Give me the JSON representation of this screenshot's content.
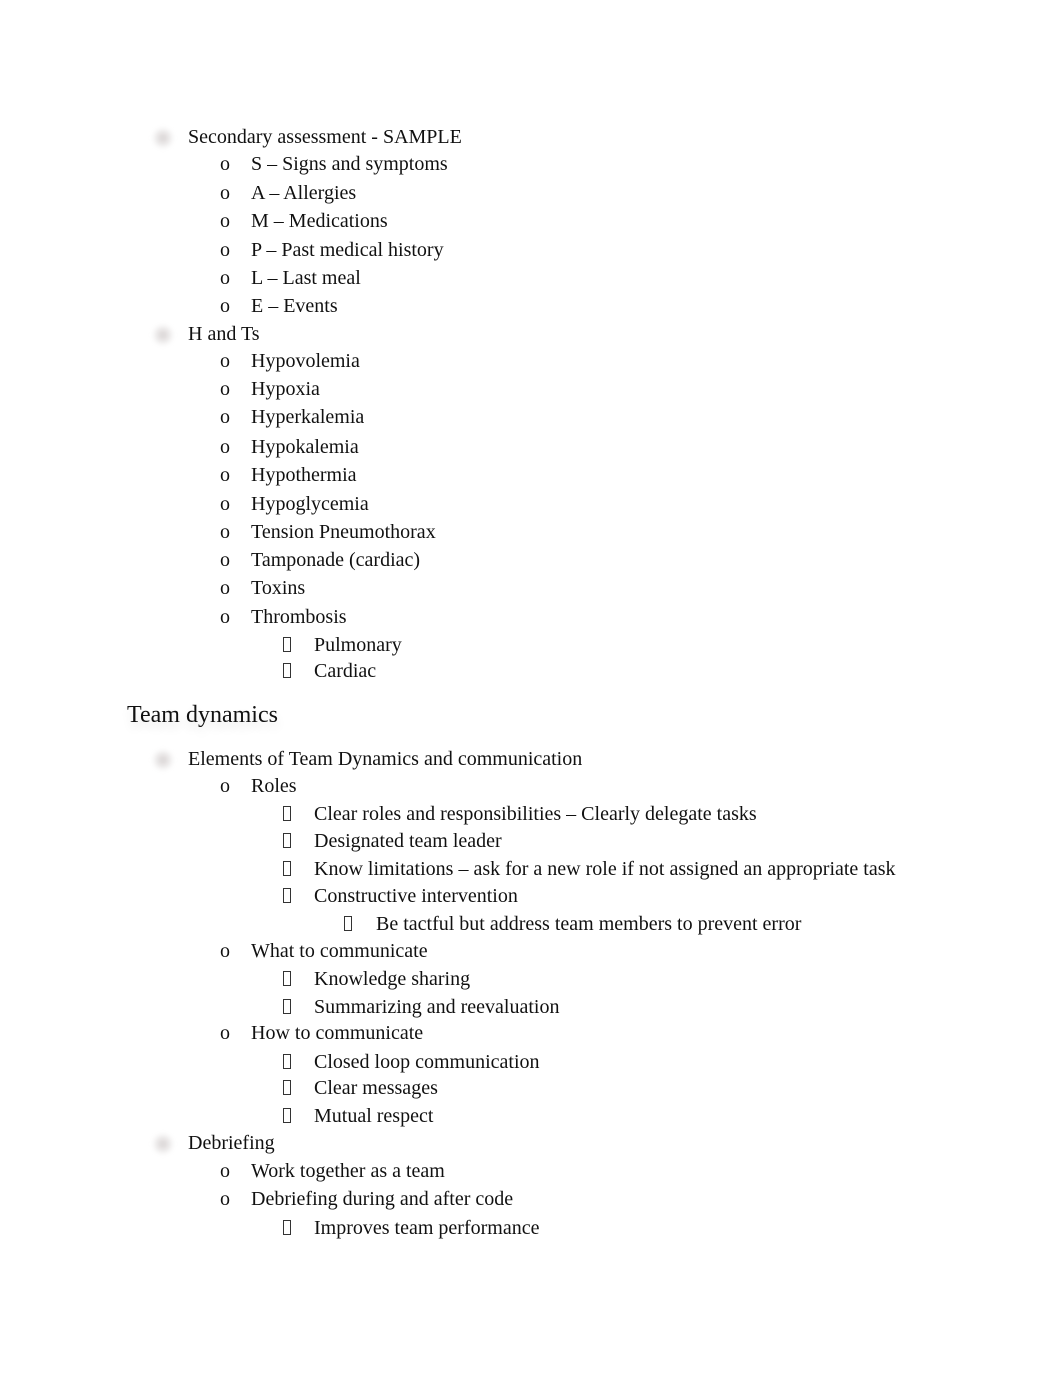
{
  "document": {
    "sections": [
      {
        "items": [
          {
            "label": "Secondary assessment - SAMPLE",
            "children": [
              {
                "label": "S – Signs and symptoms"
              },
              {
                "label": "A – Allergies"
              },
              {
                "label": "M – Medications"
              },
              {
                "label": "P – Past medical history"
              },
              {
                "label": "L – Last meal"
              },
              {
                "label": "E – Events"
              }
            ]
          },
          {
            "label": "H and Ts",
            "children": [
              {
                "label": "Hypovolemia"
              },
              {
                "label": "Hypoxia"
              },
              {
                "label": "Hyperkalemia"
              },
              {
                "label": "Hypokalemia"
              },
              {
                "label": "Hypothermia"
              },
              {
                "label": "Hypoglycemia"
              },
              {
                "label": "Tension Pneumothorax"
              },
              {
                "label": "Tamponade (cardiac)"
              },
              {
                "label": "Toxins"
              },
              {
                "label": "Thrombosis",
                "children": [
                  {
                    "label": "Pulmonary"
                  },
                  {
                    "label": "Cardiac"
                  }
                ]
              }
            ]
          }
        ]
      },
      {
        "heading": "Team dynamics",
        "items": [
          {
            "label": "Elements of Team Dynamics and communication",
            "children": [
              {
                "label": "Roles",
                "children": [
                  {
                    "label": "Clear roles and responsibilities – Clearly delegate tasks"
                  },
                  {
                    "label": "Designated team leader"
                  },
                  {
                    "label": "Know limitations – ask for a new role if not assigned an appropriate task"
                  },
                  {
                    "label": "Constructive intervention",
                    "children": [
                      {
                        "label": "Be tactful but address team members to prevent error"
                      }
                    ]
                  }
                ]
              },
              {
                "label": "What to communicate",
                "children": [
                  {
                    "label": "Knowledge sharing"
                  },
                  {
                    "label": "Summarizing and reevaluation"
                  }
                ]
              },
              {
                "label": "How to communicate",
                "children": [
                  {
                    "label": "Closed loop communication"
                  },
                  {
                    "label": "Clear messages"
                  },
                  {
                    "label": "Mutual respect"
                  }
                ]
              }
            ]
          },
          {
            "label": "Debriefing",
            "children": [
              {
                "label": "Work together as a team"
              },
              {
                "label": "Debriefing during and after code",
                "children": [
                  {
                    "label": "Improves team performance"
                  }
                ]
              }
            ]
          }
        ]
      }
    ],
    "bullets": {
      "level2": "o"
    }
  }
}
